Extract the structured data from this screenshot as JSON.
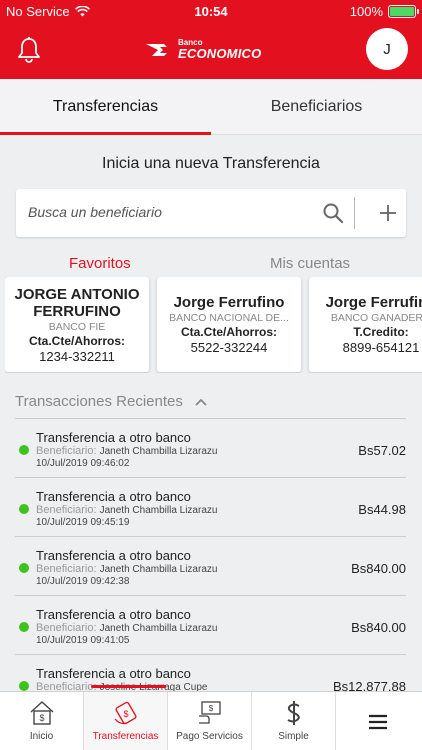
{
  "status_bar": {
    "carrier": "No Service",
    "time": "10:54",
    "battery_percent": "100%"
  },
  "header": {
    "brand_small": "Banco",
    "brand_big": "ECONOMICO",
    "avatar_initial": "J"
  },
  "tabs": [
    {
      "label": "Transferencias",
      "active": true
    },
    {
      "label": "Beneficiarios",
      "active": false
    }
  ],
  "section_title": "Inicia una nueva Transferencia",
  "search": {
    "placeholder": "Busca un beneficiario"
  },
  "sub_tabs": {
    "favorites": "Favoritos",
    "my_accounts": "Mis cuentas"
  },
  "favorites": [
    {
      "name_line1": "JORGE ANTONIO",
      "name_line2": "FERRUFINO",
      "bank": "BANCO FIE",
      "account_type": "Cta.Cte/Ahorros:",
      "account_number": "1234-332211"
    },
    {
      "name_line1": "Jorge Ferrufino",
      "name_line2": "",
      "bank": "BANCO NACIONAL DE...",
      "account_type": "Cta.Cte/Ahorros:",
      "account_number": "5522-332244"
    },
    {
      "name_line1": "Jorge Ferrufino",
      "name_line2": "",
      "bank": "BANCO GANADERO",
      "account_type": "T.Credito:",
      "account_number": "8899-654121"
    }
  ],
  "recent": {
    "title": "Transacciones Recientes",
    "transactions": [
      {
        "title": "Transferencia a otro banco",
        "beneficiary_label": "Beneficiario:",
        "beneficiary": "Janeth Chambilla Lizarazu",
        "date": "10/Jul/2019 09:46:02",
        "amount": "Bs57.02"
      },
      {
        "title": "Transferencia a otro banco",
        "beneficiary_label": "Beneficiario:",
        "beneficiary": "Janeth Chambilla Lizarazu",
        "date": "10/Jul/2019 09:45:19",
        "amount": "Bs44.98"
      },
      {
        "title": "Transferencia a otro banco",
        "beneficiary_label": "Beneficiario:",
        "beneficiary": "Janeth Chambilla Lizarazu",
        "date": "10/Jul/2019 09:42:38",
        "amount": "Bs840.00"
      },
      {
        "title": "Transferencia a otro banco",
        "beneficiary_label": "Beneficiario:",
        "beneficiary": "Janeth Chambilla Lizarazu",
        "date": "10/Jul/2019 09:41:05",
        "amount": "Bs840.00"
      },
      {
        "title": "Transferencia a otro banco",
        "beneficiary_label": "Beneficiario:",
        "beneficiary": "Joseline Lizarraga Cupe",
        "date": "",
        "amount": "Bs12,877.88"
      }
    ]
  },
  "bottom_nav": [
    {
      "label": "Inicio",
      "icon": "home-icon",
      "active": false
    },
    {
      "label": "Transferencias",
      "icon": "transfer-icon",
      "active": true
    },
    {
      "label": "Pago Servicios",
      "icon": "bill-payment-icon",
      "active": false
    },
    {
      "label": "Simple",
      "icon": "dollar-icon",
      "active": false
    },
    {
      "label": "",
      "icon": "menu-icon",
      "active": false
    }
  ],
  "colors": {
    "brand_red": "#e3111f",
    "status_green": "#3dc21e",
    "battery_green": "#4cd964"
  }
}
